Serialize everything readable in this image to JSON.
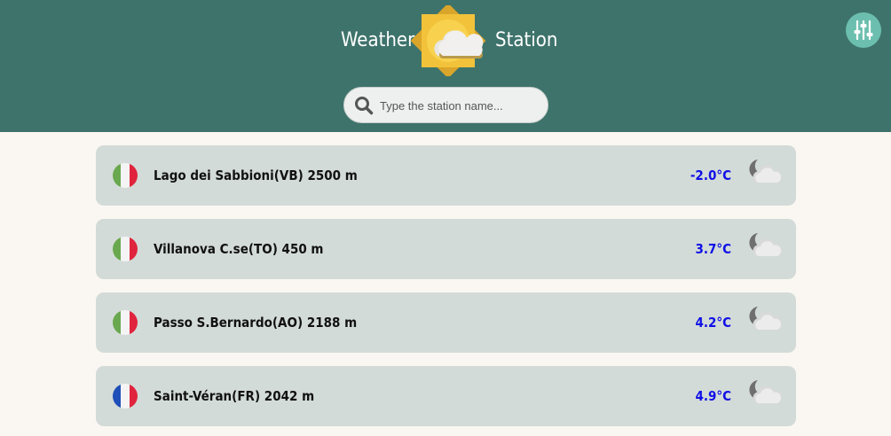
{
  "header": {
    "title_left": "Weather",
    "title_right": "Station",
    "logo_icon": "sun-cloud-icon",
    "settings_icon": "sliders-icon",
    "colors": {
      "bar": "#3e736b",
      "settings_button": "#6cbfae",
      "logo_sun": "#f5c032"
    }
  },
  "search": {
    "placeholder": "Type the station name...",
    "value": "",
    "icon": "search-icon"
  },
  "stations": [
    {
      "name": "Lago dei Sabbioni(VB) 2500 m",
      "temp": "-2.0°C",
      "flag": "italy-flag-icon",
      "weather_icon": "moon-cloud-icon"
    },
    {
      "name": "Villanova C.se(TO) 450 m",
      "temp": "3.7°C",
      "flag": "italy-flag-icon",
      "weather_icon": "moon-cloud-icon"
    },
    {
      "name": "Passo S.Bernardo(AO) 2188 m",
      "temp": "4.2°C",
      "flag": "italy-flag-icon",
      "weather_icon": "moon-cloud-icon"
    },
    {
      "name": "Saint-Véran(FR) 2042 m",
      "temp": "4.9°C",
      "flag": "france-flag-icon",
      "weather_icon": "moon-cloud-icon"
    }
  ],
  "colors": {
    "temperature": "#1010e6",
    "card": "#d3dbd8",
    "page": "#faf7f2"
  }
}
